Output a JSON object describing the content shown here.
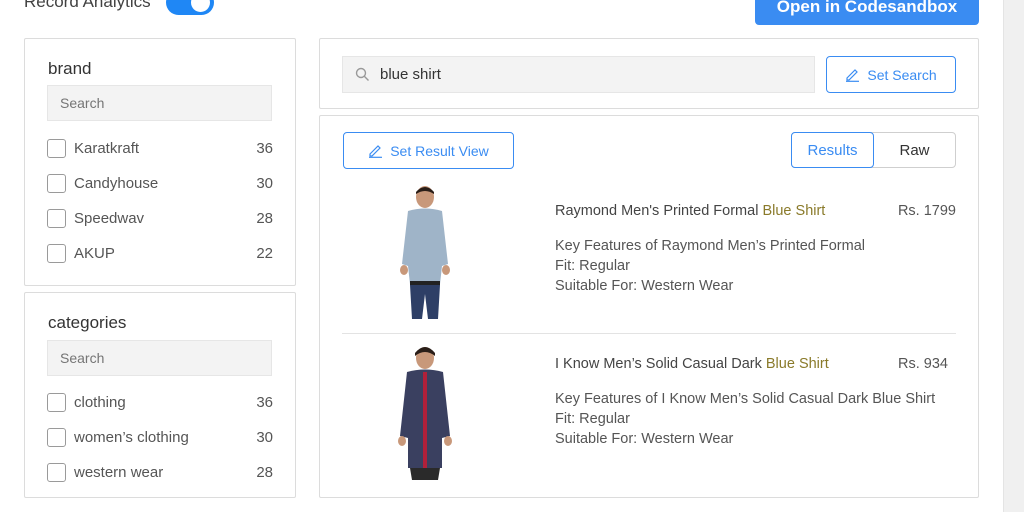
{
  "header": {
    "record_analytics_label": "Record Analytics",
    "record_analytics_on": true,
    "open_button_label": "Open in Codesandbox"
  },
  "facets": [
    {
      "title": "brand",
      "search_placeholder": "Search",
      "items": [
        {
          "label": "Karatkraft",
          "count": "36"
        },
        {
          "label": "Candyhouse",
          "count": "30"
        },
        {
          "label": "Speedwav",
          "count": "28"
        },
        {
          "label": "AKUP",
          "count": "22"
        }
      ]
    },
    {
      "title": "categories",
      "search_placeholder": "Search",
      "items": [
        {
          "label": "clothing",
          "count": "36"
        },
        {
          "label": "women’s clothing",
          "count": "30"
        },
        {
          "label": "western wear",
          "count": "28"
        }
      ]
    }
  ],
  "search": {
    "value": "blue shirt",
    "set_search_label": "Set Search"
  },
  "results_panel": {
    "set_result_view_label": "Set Result View",
    "view_options": [
      "Results",
      "Raw"
    ],
    "active_view": "Results",
    "items": [
      {
        "title_prefix": "Raymond Men's Printed Formal ",
        "title_highlight": "Blue Shirt",
        "price": "Rs. 1799",
        "desc_lines": [
          "Key Features of Raymond Men’s Printed Formal",
          "Fit: Regular",
          "Suitable For: Western Wear"
        ],
        "shirt_color": "#9fb4c8",
        "pants_color": "#2e3f66"
      },
      {
        "title_prefix": "I Know Men’s Solid Casual Dark ",
        "title_highlight": "Blue Shirt",
        "price": "Rs. 934",
        "desc_lines": [
          "Key Features of I Know Men’s Solid Casual Dark Blue Shirt",
          "Fit: Regular",
          "Suitable For: Western Wear"
        ],
        "shirt_color": "#3a4060",
        "pants_color": "#2a2a2a"
      }
    ]
  },
  "colors": {
    "accent": "#3a8cf2",
    "highlight_text": "#8a7a2a"
  }
}
